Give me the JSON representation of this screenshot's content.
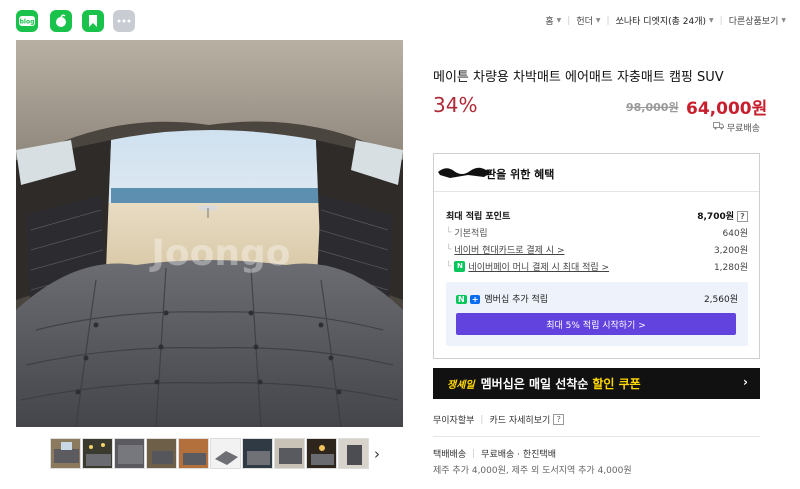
{
  "breadcrumb": {
    "home": "홈",
    "category": "헌더",
    "store": "쏘나타 디엣지(총 24개)",
    "other": "다른상품보기"
  },
  "watermark": "Joongo",
  "product": {
    "title": "메이튼 차량용 차박매트 에어매트 자충매트 캠핑 SUV",
    "discount": "34%",
    "original_price": "98,000원",
    "sale_price": "64,000원",
    "shipping": "무료배송"
  },
  "benefits": {
    "title": "을 위한 혜택",
    "title_prefix": "판",
    "max_points_label": "최대 적립 포인트",
    "max_points": "8,700원",
    "rows": [
      {
        "label": "기본적립",
        "value": "640원"
      },
      {
        "label": "네이버 현대카드로 결제 시 >",
        "value": "3,200원"
      },
      {
        "label": "네이버페이 머니 결제 시 최대 적립 >",
        "value": "1,280원"
      }
    ],
    "member_badge_n": "N",
    "member_badge_plus": "+",
    "member_label": "멤버십 추가 적립",
    "member_value": "2,560원",
    "member_cta": "최대 5% 적립 시작하기 >"
  },
  "banner": {
    "brand": "쟁셰일",
    "text": "멤버십은 매일 선착순",
    "highlight": "할인 쿠폰",
    "arrow": "›"
  },
  "payment": {
    "installment": "무이자할부",
    "card_details": "카드 자세히보기"
  },
  "delivery": {
    "method": "택배배송",
    "free": "무료배송 · 한진택배",
    "extra": "제주 추가 4,000원, 제주 외 도서지역 추가 4,000원"
  },
  "thumbnails_next": "›",
  "colors": {
    "discount_red": "#ae2a37",
    "price_red": "#c71f2e",
    "naver_green": "#03c75a",
    "membership_purple": "#6343de",
    "banner_black": "#111111",
    "banner_yellow": "#ffd700"
  }
}
